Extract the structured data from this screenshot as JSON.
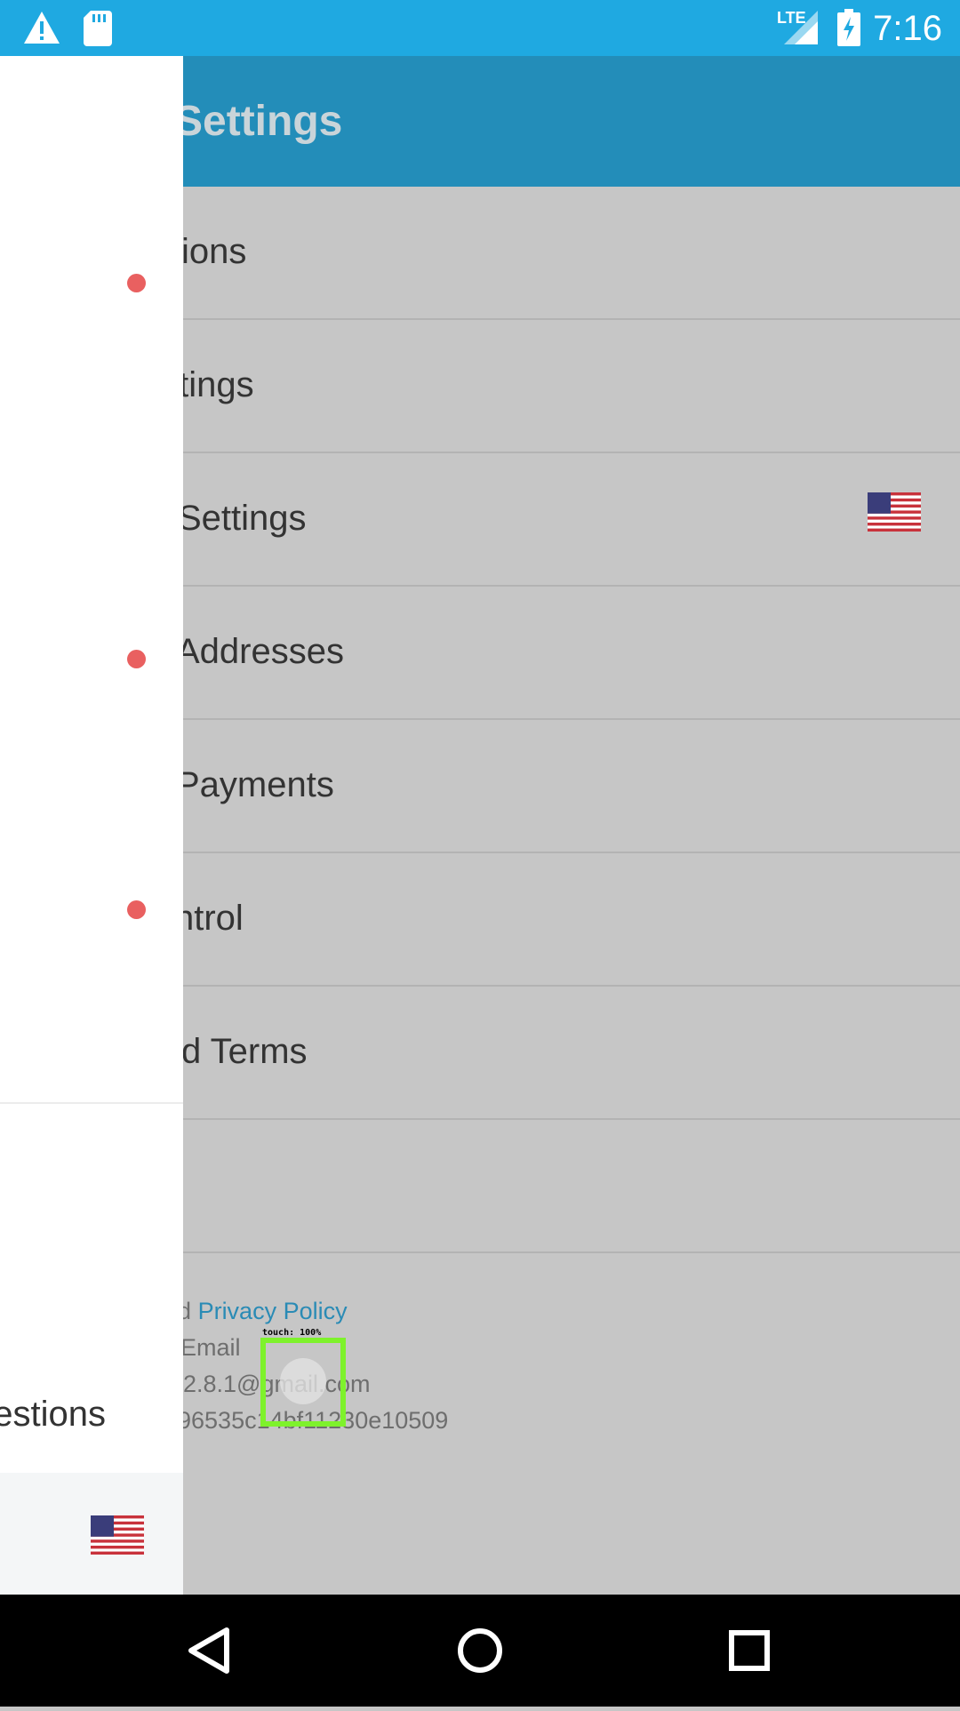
{
  "status_bar": {
    "time": "7:16",
    "network": "LTE",
    "icons": [
      "warning-icon",
      "sd-card-icon",
      "lte-signal-icon",
      "battery-charging-icon"
    ]
  },
  "app_bar": {
    "title": "Settings"
  },
  "settings": {
    "rows": [
      {
        "label": "ions"
      },
      {
        "label": "ttings"
      },
      {
        "label": " Settings"
      },
      {
        "label": " Addresses"
      },
      {
        "label": " Payments"
      },
      {
        "label": "ntrol"
      },
      {
        "label": "d Terms"
      },
      {
        "label": ""
      }
    ]
  },
  "footer": {
    "line1_prefix": " and ",
    "privacy_link": "Privacy Policy",
    "line2": ": Email",
    "line3": "2.8.1@gmail.com",
    "line4": "96535c14bf11230e10509"
  },
  "drawer": {
    "faq_label": "uestions",
    "flag": "us-flag-icon"
  },
  "touch_indicator": {
    "label": "touch: 100%"
  },
  "colors": {
    "status_bar": "#1fa9e1",
    "app_bar": "#238db9",
    "scrim_bg": "#c6c6c6",
    "badge_dot": "#e96060",
    "link": "#2a8bb5",
    "touch_box": "#7ef22c"
  },
  "nav_bar": {
    "buttons": [
      "back-button",
      "home-button",
      "recents-button"
    ]
  }
}
